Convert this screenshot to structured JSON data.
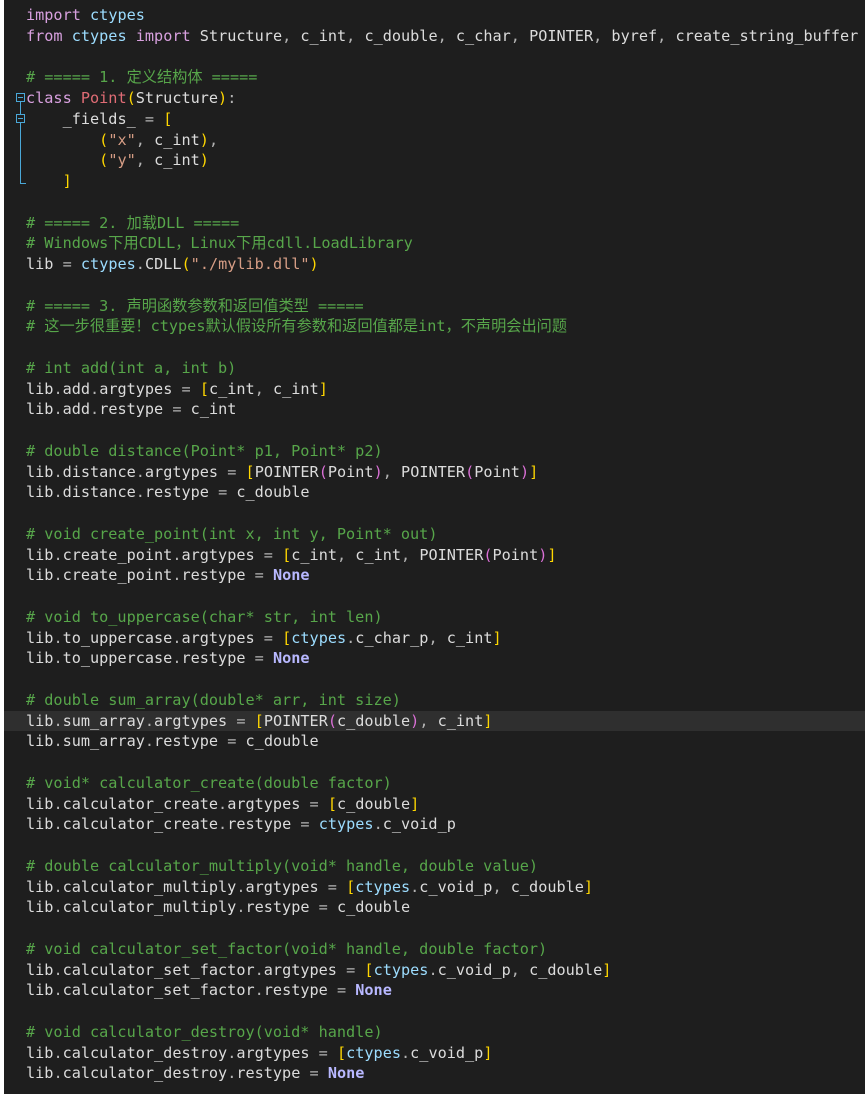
{
  "editor": {
    "language": "python",
    "theme_colors": {
      "background": "#1e1e1e",
      "comment": "#57a64a",
      "keyword": "#d8a0df",
      "string": "#d69d85",
      "class_name": "#e06c75",
      "current_line": "#2f2f2f"
    },
    "lines": [
      "import ctypes",
      "from ctypes import Structure, c_int, c_double, c_char, POINTER, byref, create_string_buffer",
      "",
      "# ===== 1. 定义结构体 =====",
      "class Point(Structure):",
      "    _fields_ = [",
      "        (\"x\", c_int),",
      "        (\"y\", c_int)",
      "    ]",
      "",
      "# ===== 2. 加载DLL =====",
      "# Windows下用CDLL，Linux下用cdll.LoadLibrary",
      "lib = ctypes.CDLL(\"./mylib.dll\")",
      "",
      "# ===== 3. 声明函数参数和返回值类型 =====",
      "# 这一步很重要！ctypes默认假设所有参数和返回值都是int，不声明会出问题",
      "",
      "# int add(int a, int b)",
      "lib.add.argtypes = [c_int, c_int]",
      "lib.add.restype = c_int",
      "",
      "# double distance(Point* p1, Point* p2)",
      "lib.distance.argtypes = [POINTER(Point), POINTER(Point)]",
      "lib.distance.restype = c_double",
      "",
      "# void create_point(int x, int y, Point* out)",
      "lib.create_point.argtypes = [c_int, c_int, POINTER(Point)]",
      "lib.create_point.restype = None",
      "",
      "# void to_uppercase(char* str, int len)",
      "lib.to_uppercase.argtypes = [ctypes.c_char_p, c_int]",
      "lib.to_uppercase.restype = None",
      "",
      "# double sum_array(double* arr, int size)",
      "lib.sum_array.argtypes = [POINTER(c_double), c_int]",
      "lib.sum_array.restype = c_double",
      "",
      "# void* calculator_create(double factor)",
      "lib.calculator_create.argtypes = [c_double]",
      "lib.calculator_create.restype = ctypes.c_void_p",
      "",
      "# double calculator_multiply(void* handle, double value)",
      "lib.calculator_multiply.argtypes = [ctypes.c_void_p, c_double]",
      "lib.calculator_multiply.restype = c_double",
      "",
      "# void calculator_set_factor(void* handle, double factor)",
      "lib.calculator_set_factor.argtypes = [ctypes.c_void_p, c_double]",
      "lib.calculator_set_factor.restype = None",
      "",
      "# void calculator_destroy(void* handle)",
      "lib.calculator_destroy.argtypes = [ctypes.c_void_p]",
      "lib.calculator_destroy.restype = None"
    ],
    "current_line_number": 35
  }
}
